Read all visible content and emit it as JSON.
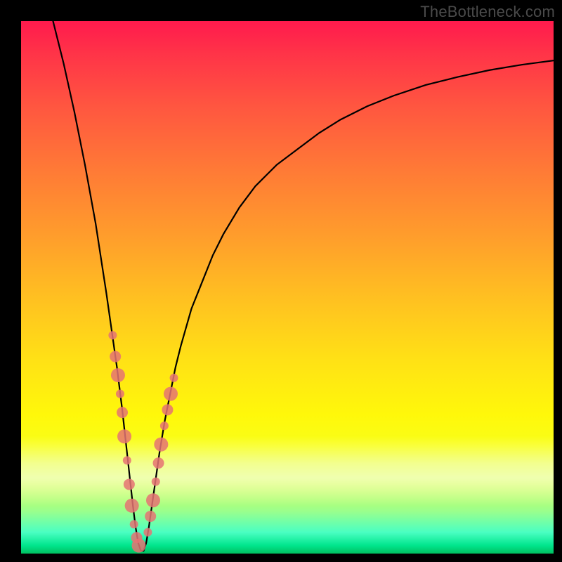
{
  "watermark": "TheBottleneck.com",
  "chart_data": {
    "type": "line",
    "title": "",
    "xlabel": "",
    "ylabel": "",
    "xlim": [
      0,
      100
    ],
    "ylim": [
      0,
      100
    ],
    "grid": false,
    "series": [
      {
        "name": "bottleneck-curve",
        "color": "#000000",
        "x": [
          6,
          8,
          10,
          12,
          14,
          16,
          17,
          18,
          19,
          20,
          21,
          21.5,
          22,
          22.5,
          23,
          23.5,
          24,
          25,
          26,
          27,
          28,
          29,
          30,
          32,
          34,
          36,
          38,
          41,
          44,
          48,
          52,
          56,
          60,
          65,
          70,
          76,
          82,
          88,
          94,
          100
        ],
        "y": [
          100,
          92,
          83,
          73,
          62,
          49,
          42,
          35,
          27,
          18,
          9,
          5,
          2,
          0.5,
          0.5,
          2,
          5,
          12,
          19,
          25,
          30,
          35,
          39,
          46,
          51,
          56,
          60,
          65,
          69,
          73,
          76,
          79,
          81.5,
          84,
          86,
          88,
          89.5,
          90.8,
          91.8,
          92.6
        ]
      },
      {
        "name": "highlight-dots-left",
        "color": "#e57373",
        "x": [
          17.2,
          17.7,
          18.2,
          18.6,
          19.0,
          19.4,
          19.9,
          20.3,
          20.8,
          21.2,
          21.7,
          22.1
        ],
        "y": [
          41.0,
          37.0,
          33.5,
          30.0,
          26.5,
          22.0,
          17.5,
          13.0,
          9.0,
          5.5,
          3.0,
          1.5
        ]
      },
      {
        "name": "highlight-dots-right",
        "color": "#e57373",
        "x": [
          23.8,
          24.3,
          24.8,
          25.3,
          25.8,
          26.3,
          26.9,
          27.5,
          28.1,
          28.7
        ],
        "y": [
          4.0,
          7.0,
          10.0,
          13.5,
          17.0,
          20.5,
          24.0,
          27.0,
          30.0,
          33.0
        ]
      }
    ]
  }
}
